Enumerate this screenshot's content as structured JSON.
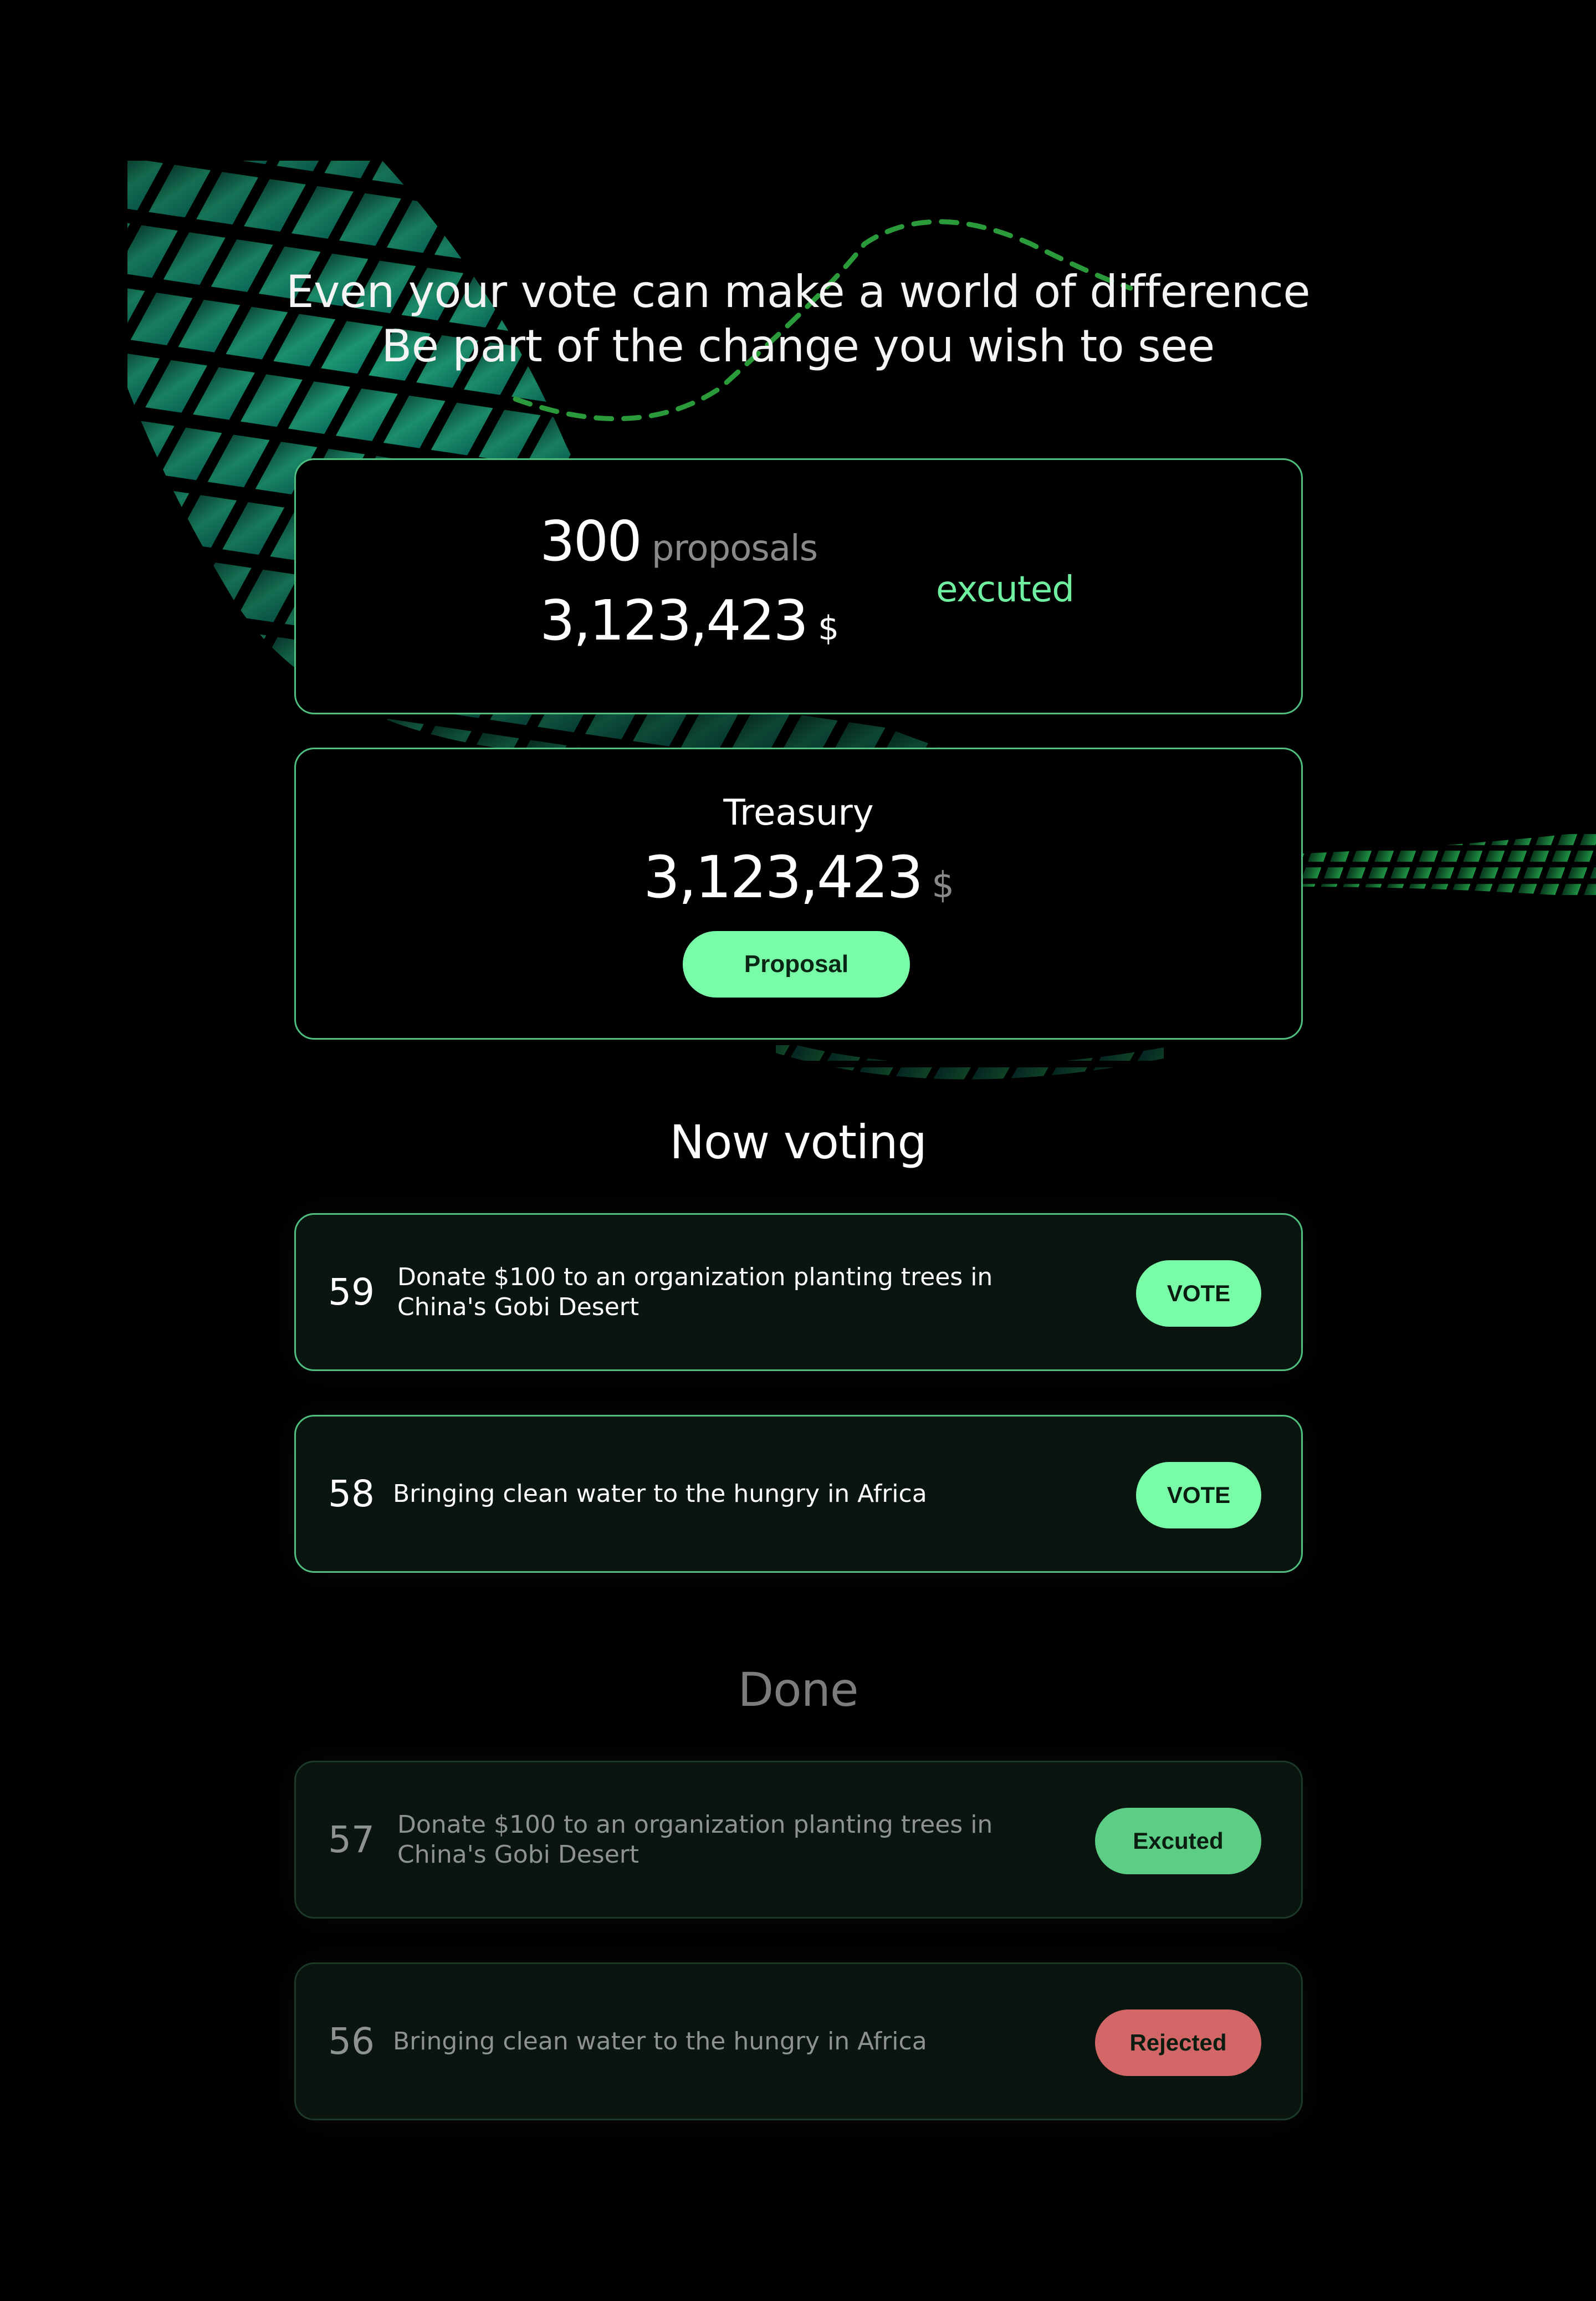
{
  "headline": {
    "line1": "Even your vote can make a world of difference",
    "line2": "Be part of the change you wish to see"
  },
  "stats": {
    "proposals_count": "300",
    "proposals_label": "proposals",
    "amount": "3,123,423",
    "currency": "$",
    "status": "excuted"
  },
  "treasury": {
    "title": "Treasury",
    "amount": "3,123,423",
    "currency": "$",
    "button_label": "Proposal"
  },
  "now_voting": {
    "title": "Now voting",
    "items": [
      {
        "number": "59",
        "text": "Donate $100 to an organization planting trees in China's Gobi Desert",
        "button": "VOTE"
      },
      {
        "number": "58",
        "text": "Bringing clean water to the hungry in Africa",
        "button": "VOTE"
      }
    ]
  },
  "done": {
    "title": "Done",
    "items": [
      {
        "number": "57",
        "text": "Donate $100 to an organization planting trees in China's Gobi Desert",
        "status": "Excuted"
      },
      {
        "number": "56",
        "text": "Bringing clean water to the hungry in Africa",
        "status": "Rejected"
      }
    ]
  },
  "colors": {
    "accent": "#78fca7",
    "accent_border": "#4fbf7f",
    "excuted": "#5ccd84",
    "rejected": "#d36767",
    "background": "#000000"
  }
}
